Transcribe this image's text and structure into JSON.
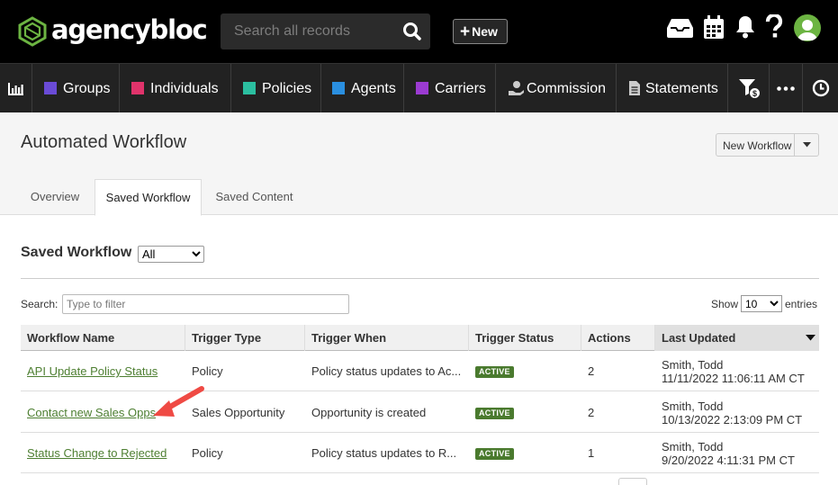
{
  "brand": {
    "name": "agencybloc",
    "accent": "#6cb442"
  },
  "topbar": {
    "search_placeholder": "Search all records",
    "new_label": "New",
    "icons": [
      "inbox-icon",
      "calendar-icon",
      "bell-icon",
      "help-icon",
      "user-avatar"
    ]
  },
  "nav": {
    "items": [
      {
        "label": "",
        "icon": "bar-chart-icon"
      },
      {
        "label": "Groups",
        "color": "#6a4bd6"
      },
      {
        "label": "Individuals",
        "color": "#e0336b"
      },
      {
        "label": "Policies",
        "color": "#2bbfa0"
      },
      {
        "label": "Agents",
        "color": "#2a8fe0"
      },
      {
        "label": "Carriers",
        "color": "#9b3bd1"
      },
      {
        "label": "Commission",
        "icon": "hand-coin-icon"
      },
      {
        "label": "Statements",
        "icon": "document-icon"
      },
      {
        "label": "",
        "icon": "filter-dollar-icon"
      },
      {
        "label": "",
        "icon": "more-icon"
      },
      {
        "label": "",
        "icon": "clock-icon"
      }
    ]
  },
  "page": {
    "title": "Automated Workflow",
    "new_workflow_label": "New Workflow",
    "tabs": [
      {
        "label": "Overview"
      },
      {
        "label": "Saved Workflow",
        "active": true
      },
      {
        "label": "Saved Content"
      }
    ]
  },
  "section": {
    "title": "Saved Workflow",
    "filter_value": "All",
    "search_label": "Search:",
    "search_placeholder": "Type to filter",
    "show_label": "Show",
    "show_value": "10",
    "entries_label": "entries"
  },
  "table": {
    "columns": [
      "Workflow Name",
      "Trigger Type",
      "Trigger When",
      "Trigger Status",
      "Actions",
      "Last Updated"
    ],
    "sorted_column": "Last Updated",
    "rows": [
      {
        "name": "API Update Policy Status",
        "type": "Policy",
        "when": "Policy status updates to Ac...",
        "status": "ACTIVE",
        "actions": "2",
        "updated_by": "Smith, Todd",
        "updated_at": "11/11/2022 11:06:11 AM CT"
      },
      {
        "name": "Contact new Sales Opps",
        "type": "Sales Opportunity",
        "when": "Opportunity is created",
        "status": "ACTIVE",
        "actions": "2",
        "updated_by": "Smith, Todd",
        "updated_at": "10/13/2022 2:13:09 PM CT"
      },
      {
        "name": "Status Change to Rejected",
        "type": "Policy",
        "when": "Policy status updates to R...",
        "status": "ACTIVE",
        "actions": "1",
        "updated_by": "Smith, Todd",
        "updated_at": "9/20/2022 4:11:31 PM CT"
      }
    ]
  },
  "annotation": {
    "arrow_color": "#ef4a44"
  }
}
